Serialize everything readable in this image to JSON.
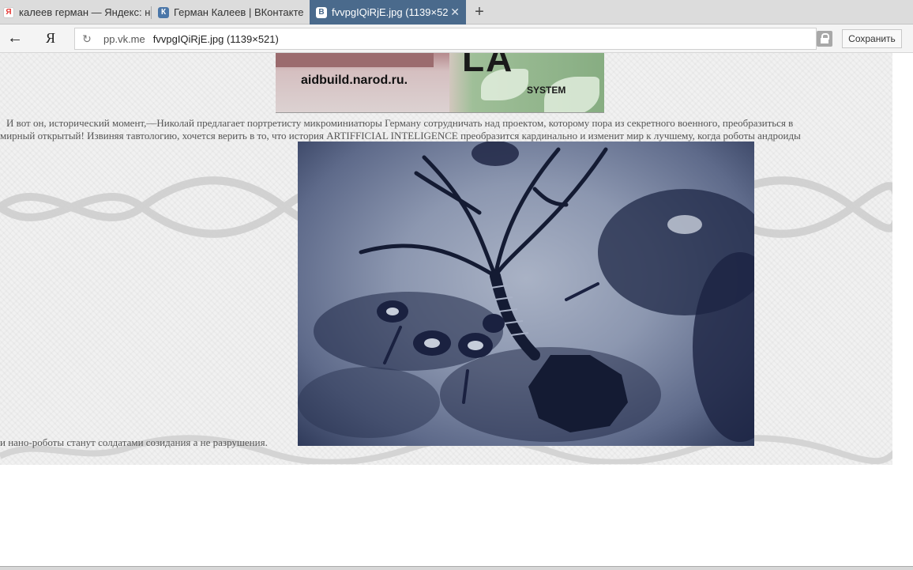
{
  "tabs": [
    {
      "label": "калеев герман — Яндекс: н",
      "favicon": "yandex-icon"
    },
    {
      "label": "Герман Калеев | ВКонтакте",
      "favicon": "vk-icon"
    },
    {
      "label": "fvvpgIQiRjE.jpg (1139×52",
      "favicon": "vk-icon",
      "active": true
    }
  ],
  "toolbar": {
    "back_icon": "←",
    "yandex_logo": "Я",
    "reload_icon": "↻",
    "domain": "pp.vk.me",
    "title": "fvvpgIQiRjE.jpg (1139×521)",
    "save_label": "Сохранить",
    "new_tab_icon": "+",
    "close_tab_icon": "✕"
  },
  "banner": {
    "site": "aidbuild.narod.ru.",
    "logo_text": "LA",
    "logo_sub": "SYSTEM"
  },
  "article": {
    "line1": "И вот он, исторический момент,—Николай предлагает портретисту микроминиатюры Герману сотрудничать над проектом, которому пора из секретного военного, преобразиться в",
    "line2": "мирный открытый! Извиняя тавтологию, хочется верить в то, что история ARTIFFICIAL INTELIGENCE преобразится кардинально и изменит мир к лучшему, когда роботы андроиды",
    "caption": "и нано-роботы станут солдатами созидания а не разрушения."
  },
  "colors": {
    "active_tab": "#4a6a8c",
    "page_bg": "#f1f1f1",
    "text": "#555555"
  }
}
